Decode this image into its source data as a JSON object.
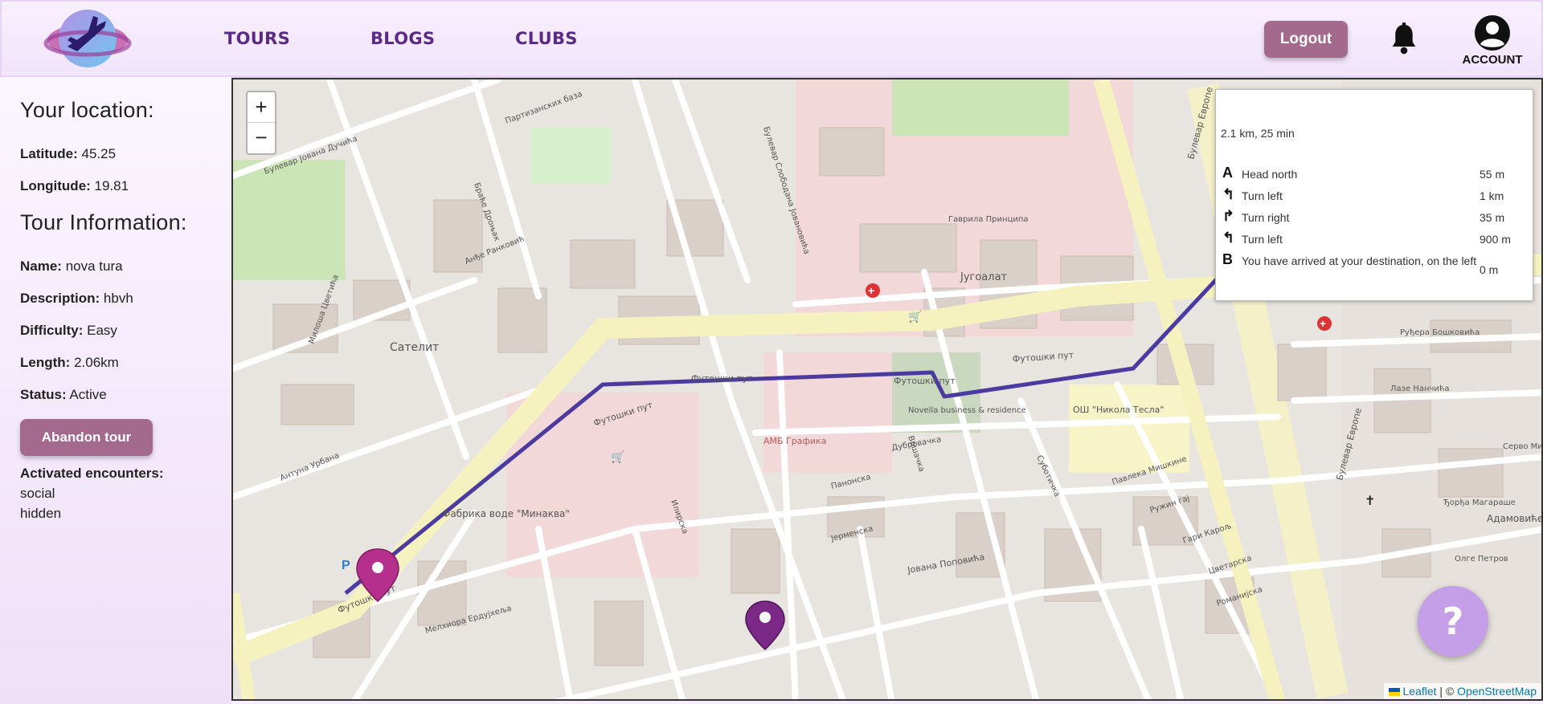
{
  "nav": {
    "links": [
      "TOURS",
      "BLOGS",
      "CLUBS"
    ],
    "logout_label": "Logout",
    "account_label": "ACCOUNT"
  },
  "sidebar": {
    "location_heading": "Your location:",
    "latitude_label": "Latitude:",
    "latitude_value": "45.25",
    "longitude_label": "Longitude:",
    "longitude_value": "19.81",
    "tour_heading": "Tour Information:",
    "name_label": "Name:",
    "name_value": "nova tura",
    "description_label": "Description:",
    "description_value": "hbvh",
    "difficulty_label": "Difficulty:",
    "difficulty_value": "Easy",
    "length_label": "Length:",
    "length_value": "2.06km",
    "status_label": "Status:",
    "status_value": "Active",
    "abandon_label": "Abandon tour",
    "encounters_label": "Activated encounters:",
    "encounters": [
      "social",
      "hidden"
    ]
  },
  "map": {
    "zoom_in": "+",
    "zoom_out": "−",
    "route_summary": "2.1 km, 25 min",
    "instructions": [
      {
        "icon": "A",
        "text": "Head north",
        "distance": "55 m"
      },
      {
        "icon": "↰",
        "text": "Turn left",
        "distance": "1 km"
      },
      {
        "icon": "↱",
        "text": "Turn right",
        "distance": "35 m"
      },
      {
        "icon": "↰",
        "text": "Turn left",
        "distance": "900 m"
      },
      {
        "icon": "B",
        "text": "You have arrived at your destination, on the left",
        "distance": "0 m"
      }
    ],
    "street_labels": [
      "Футошки пут",
      "Футошки пут",
      "Футошки пут",
      "Футошки пут",
      "Футошки пут",
      "Сателит",
      "Југоалат",
      "Фабрика воде \"Минаква\"",
      "АМБ Графика",
      "Novella business & residence",
      "ОШ \"Никола Тесла\"",
      "Булевар Европе",
      "Булевар Европе",
      "Гаврила Принципа",
      "Јована Поповића",
      "Илирска",
      "Вршачка",
      "Дубровачка",
      "Панонска",
      "Јерменска",
      "Суботичка",
      "Павлека Мишкине",
      "Ружин гај",
      "Гари Карољ",
      "Цветарска",
      "Романијска",
      "Олге Петров",
      "Серво Ми",
      "Лазе Нанчића",
      "Руђера Бошковића",
      "Ђорђа Магараше",
      "Адамовиће насеље",
      "Партизанских база",
      "Булевар Јована Дучића",
      "Булевар Слободана Јовановића",
      "Антуна Урбана",
      "Анђе Ранковић",
      "Милоша Цветића",
      "Браће Дроњак",
      "Мелхиора Ердујхеља"
    ],
    "help_label": "?",
    "attribution_leaflet": "Leaflet",
    "attribution_sep": " | © ",
    "attribution_osm": "OpenStreetMap"
  }
}
